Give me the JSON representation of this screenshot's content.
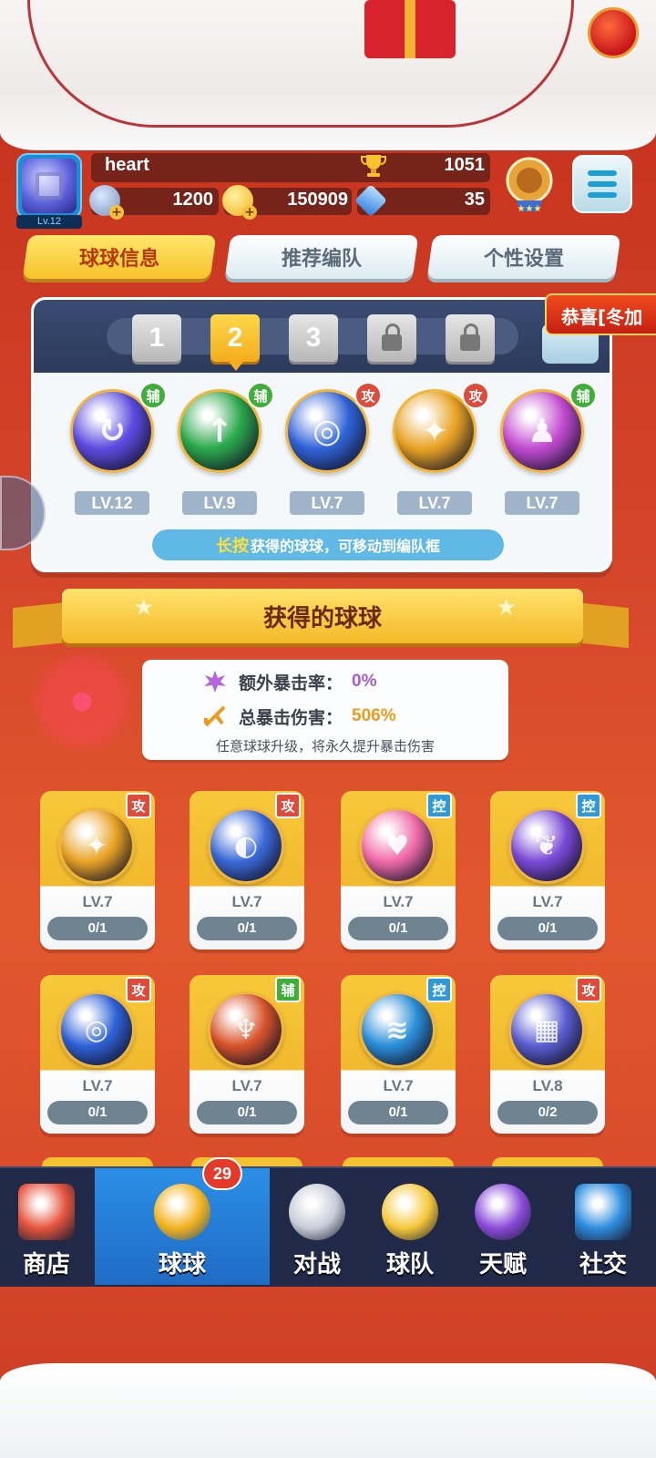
{
  "player": {
    "name": "heart",
    "level_tag": "Lv.12",
    "trophies": "1051"
  },
  "currencies": [
    {
      "icon": "star-coin-icon",
      "value": "1200"
    },
    {
      "icon": "gold-coin-icon",
      "value": "150909"
    },
    {
      "icon": "diamond-icon",
      "value": "35"
    }
  ],
  "tabs": [
    {
      "label": "球球信息",
      "active": true
    },
    {
      "label": "推荐编队",
      "active": false
    },
    {
      "label": "个性设置",
      "active": false
    }
  ],
  "congrats_banner": "恭喜[冬加",
  "team_slots": [
    "1",
    "2",
    "3"
  ],
  "team": [
    {
      "level": "LV.12",
      "tag": "辅",
      "tag_type": "sup",
      "color": "#5b4be0",
      "glyph": "↻"
    },
    {
      "level": "LV.9",
      "tag": "辅",
      "tag_type": "sup",
      "color": "#2aa84a",
      "glyph": "↑"
    },
    {
      "level": "LV.7",
      "tag": "攻",
      "tag_type": "atk",
      "color": "#2f63d8",
      "glyph": "◎"
    },
    {
      "level": "LV.7",
      "tag": "攻",
      "tag_type": "atk",
      "color": "#e9a324",
      "glyph": "✦"
    },
    {
      "level": "LV.7",
      "tag": "辅",
      "tag_type": "sup",
      "color": "#c24bd0",
      "glyph": "♟"
    }
  ],
  "hint": {
    "highlight": "长按",
    "text": "获得的球球，可移动到编队框"
  },
  "section_title": "获得的球球",
  "crit": {
    "extra_rate_label": "额外暴击率：",
    "extra_rate_value": "0%",
    "total_damage_label": "总暴击伤害：",
    "total_damage_value": "506%",
    "note": "任意球球升级，将永久提升暴击伤害"
  },
  "balls": [
    {
      "level": "LV.7",
      "progress": "0/1",
      "tag": "攻",
      "tag_type": "atk",
      "color": "#e9a324",
      "glyph": "✦"
    },
    {
      "level": "LV.7",
      "progress": "0/1",
      "tag": "攻",
      "tag_type": "atk",
      "color": "#3a6ad8",
      "glyph": "◐"
    },
    {
      "level": "LV.7",
      "progress": "0/1",
      "tag": "控",
      "tag_type": "ctl",
      "color": "#f06aa8",
      "glyph": "♥"
    },
    {
      "level": "LV.7",
      "progress": "0/1",
      "tag": "控",
      "tag_type": "ctl",
      "color": "#7b4ad6",
      "glyph": "❦"
    },
    {
      "level": "LV.7",
      "progress": "0/1",
      "tag": "攻",
      "tag_type": "atk",
      "color": "#2f63d8",
      "glyph": "◎"
    },
    {
      "level": "LV.7",
      "progress": "0/1",
      "tag": "辅",
      "tag_type": "sup",
      "color": "#d8542a",
      "glyph": "♆"
    },
    {
      "level": "LV.7",
      "progress": "0/1",
      "tag": "控",
      "tag_type": "ctl",
      "color": "#2b8fd8",
      "glyph": "≋"
    },
    {
      "level": "LV.8",
      "progress": "0/2",
      "tag": "攻",
      "tag_type": "atk",
      "color": "#5a5ed0",
      "glyph": "▦"
    }
  ],
  "nav": [
    {
      "label": "商店",
      "icon": "shop-icon",
      "active": false
    },
    {
      "label": "球球",
      "icon": "balls-icon",
      "active": true,
      "badge": "29"
    },
    {
      "label": "对战",
      "icon": "crossed-swords-icon",
      "active": false
    },
    {
      "label": "球队",
      "icon": "whistle-icon",
      "active": false
    },
    {
      "label": "天赋",
      "icon": "planet-icon",
      "active": false
    },
    {
      "label": "社交",
      "icon": "chat-heart-icon",
      "active": false
    }
  ],
  "colors": {
    "accent_yellow": "#f7c22c",
    "nav_bg": "#202a48",
    "nav_active": "#2b8fe6",
    "bg_red": "#d4452a"
  }
}
